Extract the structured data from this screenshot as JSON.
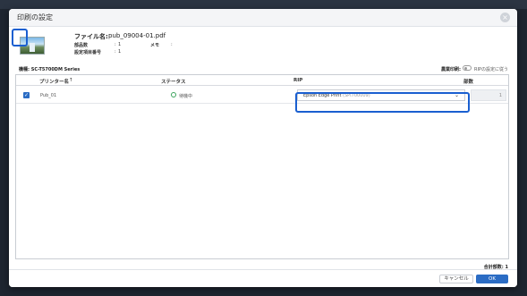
{
  "dialog": {
    "title": "印刷の設定",
    "close_glyph": "×"
  },
  "file": {
    "name_label": "ファイル名:",
    "name_value": "pub_09004-01.pdf",
    "fields": [
      {
        "label": "部品数",
        "value": "1"
      },
      {
        "label": "設定項目番号",
        "value": "1"
      }
    ],
    "memo_label": "メモ",
    "memo_value": ""
  },
  "printer_info": "機種: SC-T5700DM Series",
  "batch": {
    "label": "農業印刷:",
    "toggle_label": "RIPの設定に従う"
  },
  "table": {
    "headers": {
      "printer_name": "プリンター名",
      "sort_glyph": "↑",
      "status": "ステータス",
      "rip": "RIP",
      "copies": "部数"
    },
    "rows": [
      {
        "checked": true,
        "check_glyph": "✓",
        "printer_name": "Pub_01",
        "status": "待機中",
        "rip_value": "Epson Edge Print",
        "rip_sub": "(SPI700009)",
        "copies": "1"
      }
    ]
  },
  "total_label": "合計部数: 1",
  "buttons": {
    "cancel": "キャンセル",
    "ok": "OK"
  },
  "colors": {
    "accent": "#2b6cc4",
    "highlight": "#1a5fd0",
    "status_green": "#3aa35b"
  }
}
